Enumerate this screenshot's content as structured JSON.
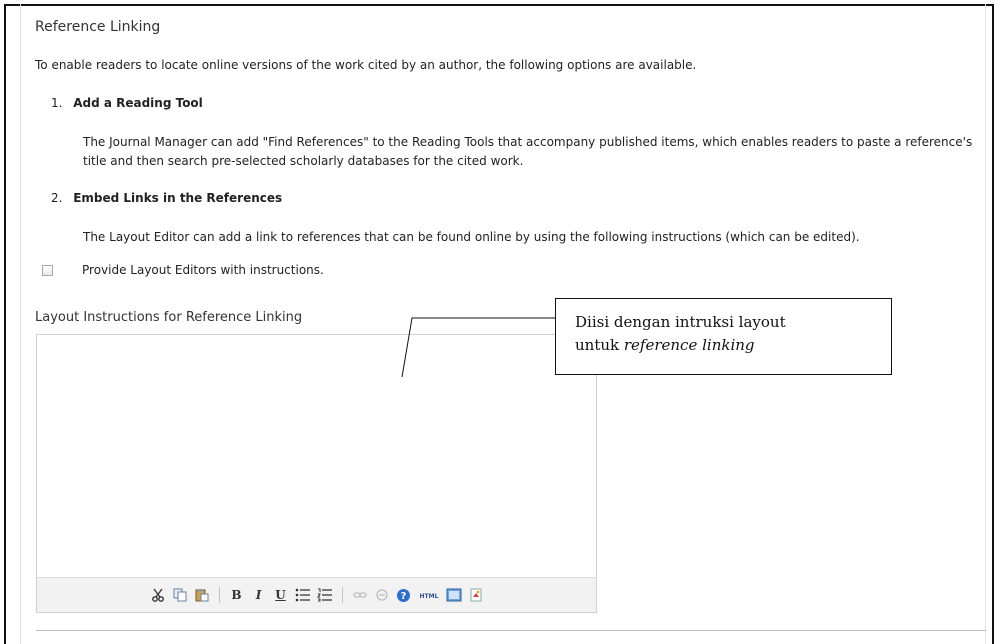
{
  "section": {
    "title": "Reference Linking",
    "intro": "To enable readers to locate online versions of the work cited by an author, the following options are available."
  },
  "options": [
    {
      "number": "1.",
      "title": "Add a Reading Tool",
      "description": "The Journal Manager can add \"Find References\" to the Reading Tools that accompany published items, which enables readers to paste a reference's title and then search pre-selected scholarly databases for the cited work."
    },
    {
      "number": "2.",
      "title": "Embed Links in the References",
      "description": "The Layout Editor can add a link to references that can be found online by using the following instructions (which can be edited)."
    }
  ],
  "checkbox": {
    "label": "Provide Layout Editors with instructions.",
    "checked": false
  },
  "editor": {
    "label": "Layout Instructions for Reference Linking",
    "value": "",
    "toolbar": {
      "bold": "B",
      "italic": "I",
      "underline": "U",
      "icons": [
        "cut-icon",
        "copy-icon",
        "paste-icon",
        "bold-icon",
        "italic-icon",
        "underline-icon",
        "bullet-list-icon",
        "numbered-list-icon",
        "link-icon",
        "unlink-icon",
        "help-icon",
        "html-source-icon",
        "fullscreen-icon",
        "image-icon"
      ]
    }
  },
  "annotation": {
    "line1": "Diisi dengan intruksi layout",
    "line2_plain": "untuk ",
    "line2_italic": "reference linking"
  }
}
